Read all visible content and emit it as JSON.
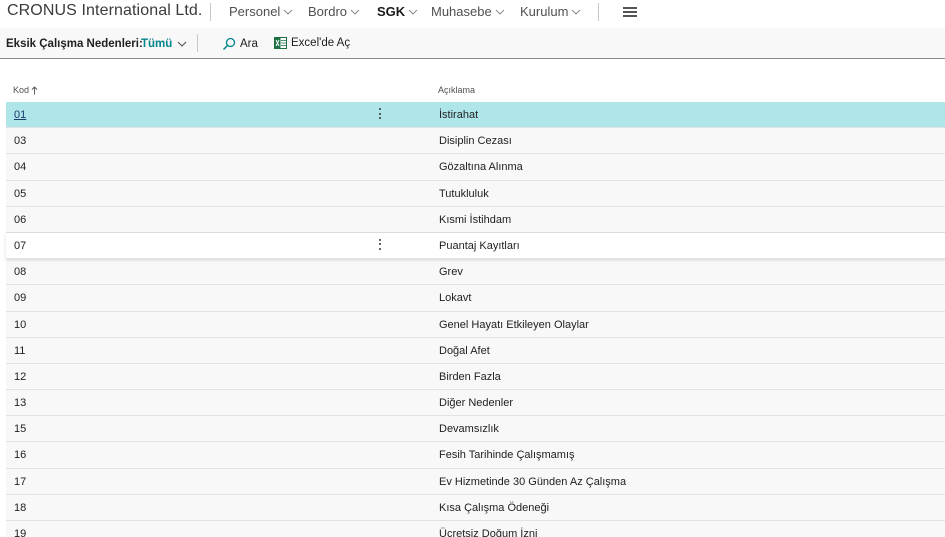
{
  "app": {
    "company": "CRONUS International Ltd."
  },
  "nav": {
    "items": [
      {
        "label": "Personel",
        "active": false
      },
      {
        "label": "Bordro",
        "active": false
      },
      {
        "label": "SGK",
        "active": true
      },
      {
        "label": "Muhasebe",
        "active": false
      },
      {
        "label": "Kurulum",
        "active": false
      }
    ],
    "menu_icon": "hamburger-icon"
  },
  "actionbar": {
    "title": "Eksik Çalışma Nedenleri:",
    "filter": "Tümü",
    "search_label": "Ara",
    "excel_label": "Excel'de Aç",
    "accent_color": "#00838a"
  },
  "table": {
    "columns": [
      "Kod",
      "Açıklama"
    ],
    "sort_icon": "arrow-up-icon",
    "rows": [
      {
        "code": "01",
        "description": "İstirahat"
      },
      {
        "code": "03",
        "description": "Disiplin Cezası"
      },
      {
        "code": "04",
        "description": "Gözaltına Alınma"
      },
      {
        "code": "05",
        "description": "Tutukluluk"
      },
      {
        "code": "06",
        "description": "Kısmi İstihdam"
      },
      {
        "code": "07",
        "description": "Puantaj Kayıtları"
      },
      {
        "code": "08",
        "description": "Grev"
      },
      {
        "code": "09",
        "description": "Lokavt"
      },
      {
        "code": "10",
        "description": "Genel Hayatı Etkileyen Olaylar"
      },
      {
        "code": "11",
        "description": "Doğal Afet"
      },
      {
        "code": "12",
        "description": "Birden Fazla"
      },
      {
        "code": "13",
        "description": "Diğer Nedenler"
      },
      {
        "code": "15",
        "description": "Devamsızlık"
      },
      {
        "code": "16",
        "description": "Fesih Tarihinde Çalışmamış"
      },
      {
        "code": "17",
        "description": "Ev Hizmetinde 30 Günden Az Çalışma"
      },
      {
        "code": "18",
        "description": "Kısa Çalışma Ödeneği"
      },
      {
        "code": "19",
        "description": "Ücretsiz Doğum İzni"
      }
    ],
    "selected_row": "01",
    "hover_row": "07",
    "selected_color": "#afe6ea"
  }
}
